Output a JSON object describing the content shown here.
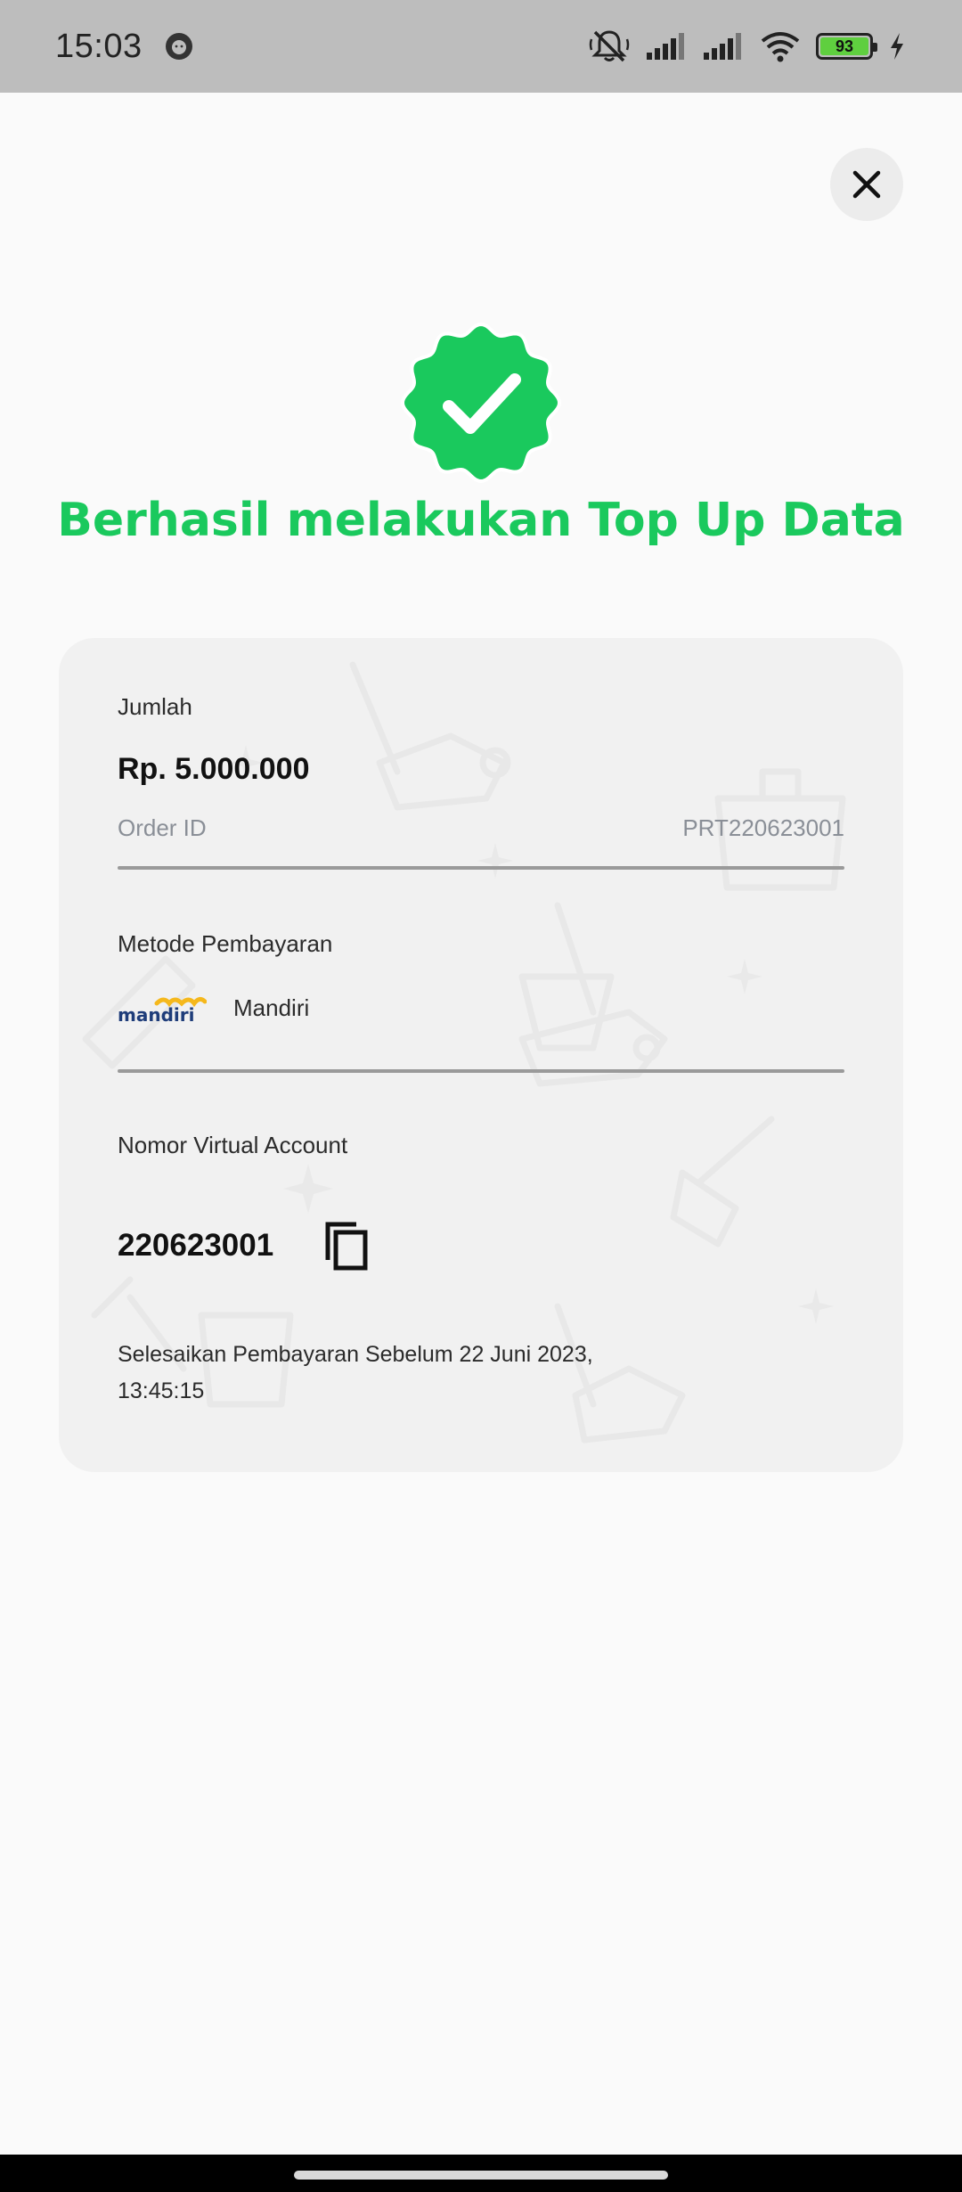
{
  "status_bar": {
    "time": "15:03",
    "battery_level": "93",
    "icons": [
      "avatar-icon",
      "mute-icon",
      "signal-icon",
      "signal-icon",
      "wifi-icon",
      "battery-icon",
      "charging-icon"
    ]
  },
  "header": {
    "close_icon": "close-icon"
  },
  "success": {
    "icon": "verified-badge-icon",
    "title": "Berhasil melakukan Top Up Data",
    "color": "#1ac95d"
  },
  "payment": {
    "amount_label": "Jumlah",
    "amount_value": "Rp. 5.000.000",
    "order_id_label": "Order ID",
    "order_id_value": "PRT220623001",
    "method_label": "Metode Pembayaran",
    "method_logo_text": "mandiri",
    "method_name": "Mandiri",
    "va_label": "Nomor Virtual Account",
    "va_number": "220623001",
    "copy_icon": "copy-icon",
    "deadline_line1": "Selesaikan Pembayaran Sebelum 22 Juni 2023,",
    "deadline_line2": "13:45:15"
  }
}
